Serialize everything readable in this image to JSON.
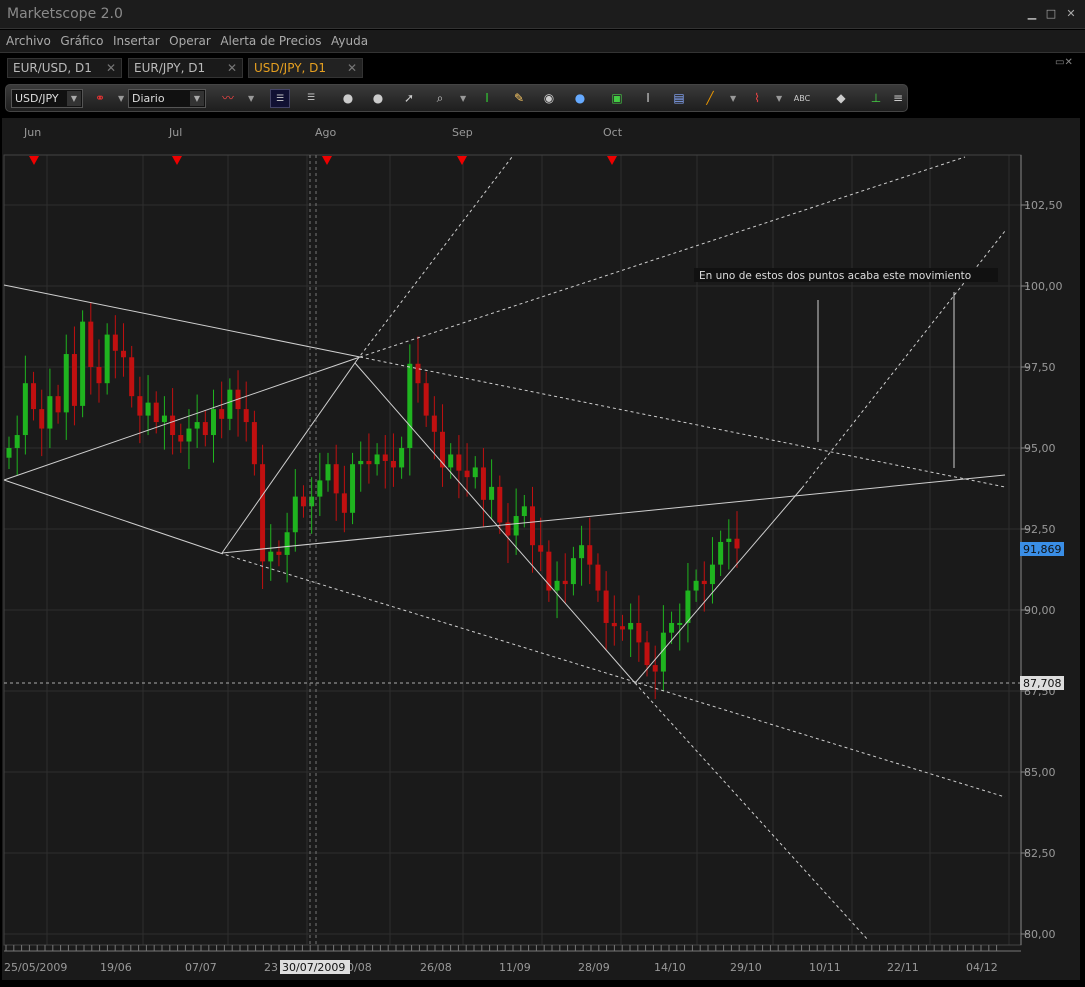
{
  "window": {
    "title": "Marketscope 2.0",
    "min": "▁",
    "max": "□",
    "close": "✕"
  },
  "menu": [
    "Archivo",
    "Gráfico",
    "Insertar",
    "Operar",
    "Alerta de Precios",
    "Ayuda"
  ],
  "tabs": [
    {
      "label": "EUR/USD, D1",
      "active": false
    },
    {
      "label": "EUR/JPY, D1",
      "active": false
    },
    {
      "label": "USD/JPY, D1",
      "active": true
    }
  ],
  "toolbar": {
    "instrument": "USD/JPY",
    "period": "Diario",
    "icons": [
      "link-icon",
      "chart-type-icon",
      "layout-b-icon",
      "layout-a-icon",
      "zoom-in-icon",
      "zoom-out-icon",
      "cursor-icon",
      "magnify-icon",
      "height-icon",
      "note-icon",
      "eye-icon",
      "globe-icon",
      "image-icon",
      "text-icon",
      "list-icon",
      "pencil-icon",
      "indicator-icon",
      "abc-icon",
      "eraser-icon",
      "tree-icon",
      "more-icon"
    ]
  },
  "chart": {
    "months": [
      "Jun",
      "Jul",
      "Ago",
      "Sep",
      "Oct"
    ],
    "price_ticks": [
      "102,50",
      "100,00",
      "97,50",
      "95,00",
      "92,50",
      "90,00",
      "87,50",
      "85,00",
      "82,50",
      "80,00"
    ],
    "date_ticks": [
      "25/05/2009",
      "19/06",
      "07/07",
      "23",
      "0/08",
      "26/08",
      "11/09",
      "28/09",
      "14/10",
      "29/10",
      "10/11",
      "22/11",
      "04/12"
    ],
    "cursor_date": "30/07/2009",
    "current_price": "91,869",
    "cursor_price": "87,708",
    "annotation": "En uno de estos dos puntos acaba este movimiento",
    "colors": {
      "up": "#1fb41f",
      "down": "#c01010",
      "current": "#3a8ee6"
    }
  },
  "chart_data": {
    "type": "candlestick",
    "symbol": "USD/JPY",
    "timeframe": "D1",
    "ylim": [
      79.5,
      104
    ],
    "closes": [
      95.0,
      95.4,
      97.0,
      96.2,
      95.6,
      96.6,
      96.1,
      97.9,
      96.3,
      98.9,
      97.5,
      97.0,
      98.5,
      98.0,
      97.8,
      96.6,
      96.0,
      96.4,
      95.8,
      96.0,
      95.4,
      95.2,
      95.6,
      95.8,
      95.4,
      96.2,
      95.9,
      96.8,
      96.2,
      95.8,
      94.5,
      91.5,
      91.8,
      91.7,
      92.4,
      93.5,
      93.2,
      93.5,
      94.0,
      94.5,
      93.6,
      93.0,
      94.5,
      94.6,
      94.5,
      94.8,
      94.6,
      94.4,
      95.0,
      97.6,
      97.0,
      96.0,
      95.5,
      94.4,
      94.8,
      94.3,
      94.1,
      94.4,
      93.4,
      93.8,
      92.7,
      92.3,
      92.9,
      93.2,
      92.0,
      91.8,
      90.6,
      90.9,
      90.8,
      91.6,
      92.0,
      91.4,
      90.6,
      89.6,
      89.5,
      89.4,
      89.6,
      89.0,
      88.3,
      88.1,
      89.3,
      89.6,
      89.6,
      90.6,
      90.9,
      90.8,
      91.4,
      92.1,
      92.2,
      91.9
    ]
  }
}
